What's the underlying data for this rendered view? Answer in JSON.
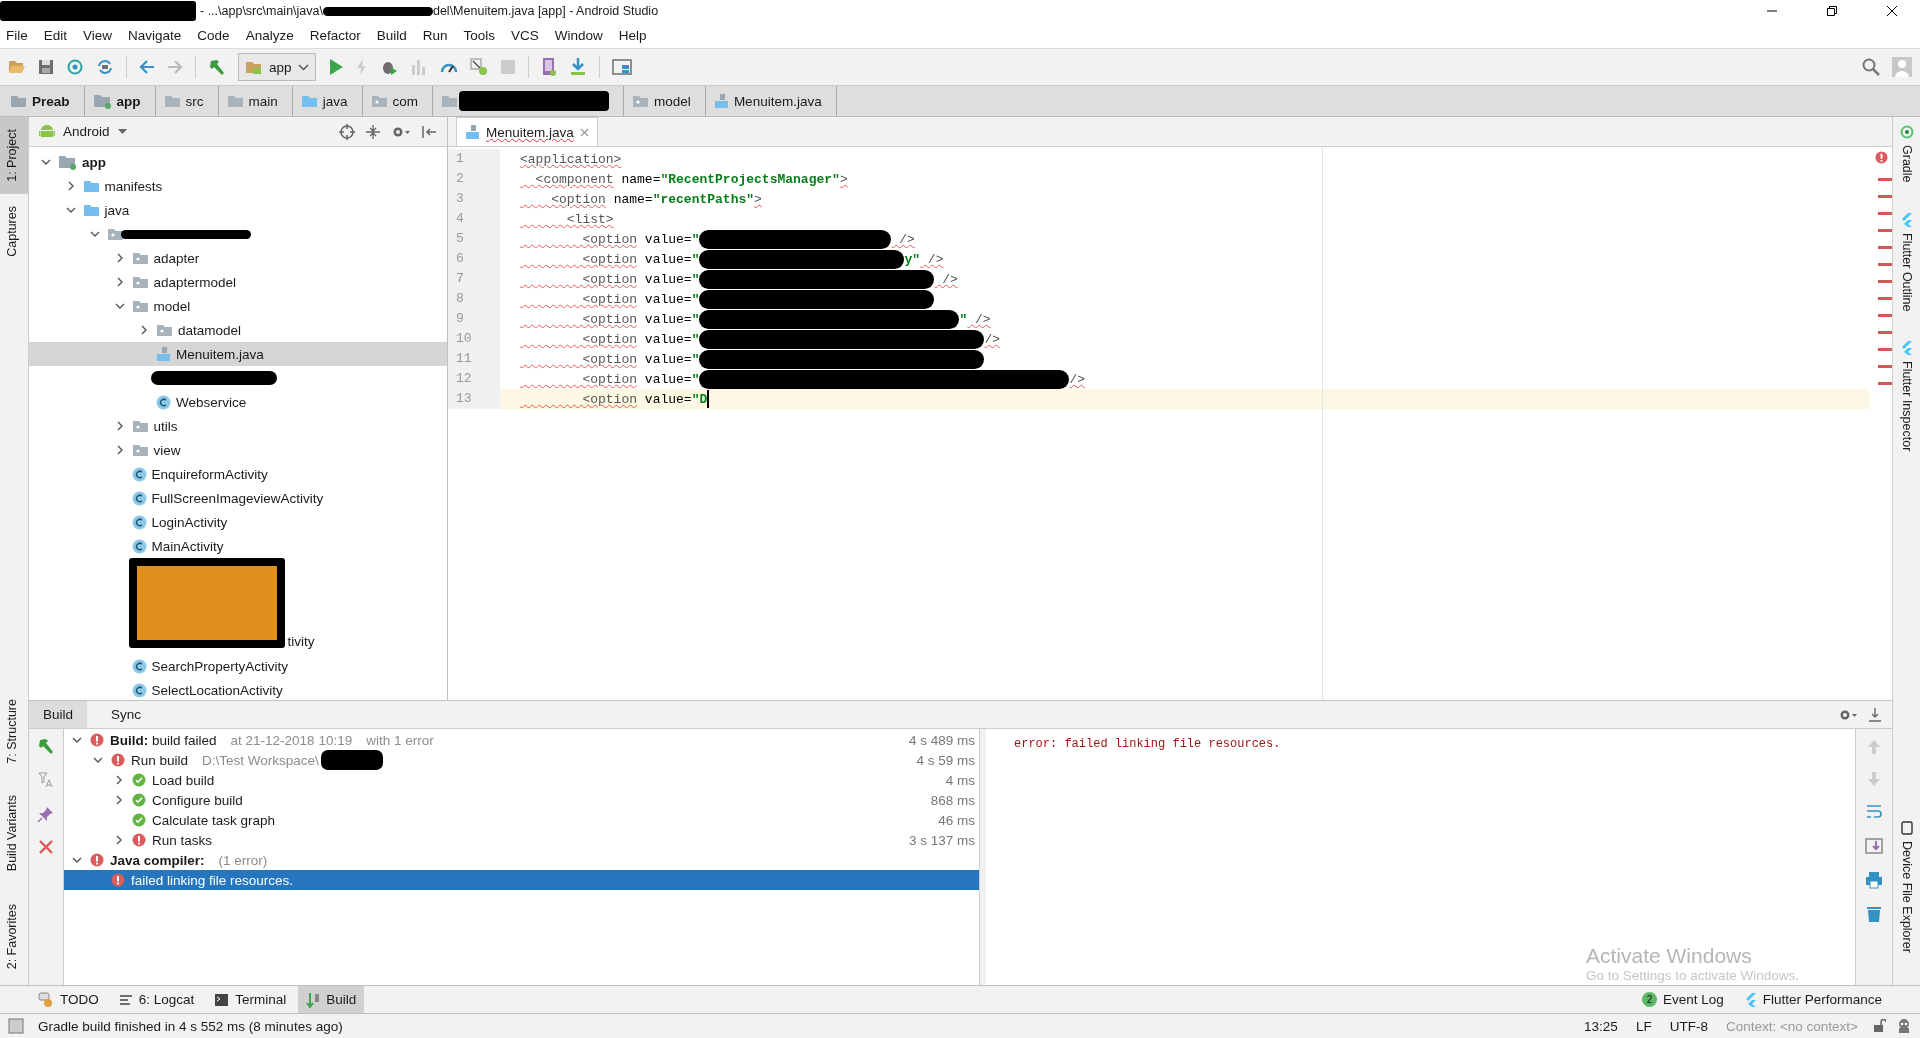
{
  "window": {
    "title_parts": [
      "- ...\\app\\src\\main\\java\\",
      "del\\Menuitem.java [app] - Android Studio"
    ]
  },
  "menu": [
    "File",
    "Edit",
    "View",
    "Navigate",
    "Code",
    "Analyze",
    "Refactor",
    "Build",
    "Run",
    "Tools",
    "VCS",
    "Window",
    "Help"
  ],
  "toolbar": {
    "run_config": "app"
  },
  "breadcrumbs": [
    {
      "label": "Preab",
      "kind": "project"
    },
    {
      "label": "app",
      "kind": "module"
    },
    {
      "label": "src",
      "kind": "folder"
    },
    {
      "label": "main",
      "kind": "folder"
    },
    {
      "label": "java",
      "kind": "source"
    },
    {
      "label": "com",
      "kind": "package"
    },
    {
      "kind": "redacted"
    },
    {
      "label": "model",
      "kind": "package"
    },
    {
      "label": "Menuitem.java",
      "kind": "file"
    }
  ],
  "left_tools_top": [
    {
      "label": "1: Project",
      "selected": true
    },
    {
      "label": "Captures",
      "selected": false
    }
  ],
  "left_tools_bottom": [
    {
      "label": "7: Structure",
      "selected": false
    },
    {
      "label": "Build Variants",
      "selected": false
    },
    {
      "label": "2: Favorites",
      "selected": false
    }
  ],
  "right_tools": [
    {
      "label": "Gradle",
      "kind": "gradle"
    },
    {
      "label": "Flutter Outline",
      "kind": "flutter"
    },
    {
      "label": "Flutter Inspector",
      "kind": "flutter"
    },
    {
      "label": "Device File Explorer",
      "kind": "device"
    }
  ],
  "project": {
    "view": "Android",
    "tree": [
      {
        "label": "app",
        "kind": "module",
        "expanded": true,
        "selected": false,
        "children": [
          {
            "label": "manifests",
            "kind": "source",
            "expanded": false,
            "selected": false
          },
          {
            "label": "java",
            "kind": "source",
            "expanded": true,
            "selected": false,
            "children": [
              {
                "kind": "redacted-package",
                "expanded": true,
                "selected": false,
                "children": [
                  {
                    "label": "adapter",
                    "kind": "package",
                    "expanded": false,
                    "selected": false
                  },
                  {
                    "label": "adaptermodel",
                    "kind": "package",
                    "expanded": false,
                    "selected": false
                  },
                  {
                    "label": "model",
                    "kind": "package",
                    "expanded": true,
                    "selected": false,
                    "children": [
                      {
                        "label": "datamodel",
                        "kind": "package",
                        "expanded": false,
                        "selected": false
                      },
                      {
                        "label": "Menuitem.java",
                        "kind": "file",
                        "selected": true
                      },
                      {
                        "kind": "redacted",
                        "selected": false
                      },
                      {
                        "label": "Webservice",
                        "kind": "class",
                        "selected": false
                      }
                    ]
                  },
                  {
                    "label": "utils",
                    "kind": "package",
                    "expanded": false,
                    "selected": false
                  },
                  {
                    "label": "view",
                    "kind": "package",
                    "expanded": false,
                    "selected": false
                  },
                  {
                    "label": "EnquireformActivity",
                    "kind": "class",
                    "selected": false
                  },
                  {
                    "label": "FullScreenImageviewActivity",
                    "kind": "class",
                    "selected": false
                  },
                  {
                    "label": "LoginActivity",
                    "kind": "class",
                    "selected": false
                  },
                  {
                    "label": "MainActivity",
                    "kind": "class",
                    "selected": false
                  },
                  {
                    "label": "tivity",
                    "kind": "covered",
                    "selected": false
                  },
                  {
                    "label": "SearchPropertyActivity",
                    "kind": "class",
                    "selected": false
                  },
                  {
                    "label": "SelectLocationActivity",
                    "kind": "class",
                    "selected": false
                  }
                ]
              }
            ]
          }
        ]
      }
    ]
  },
  "editor": {
    "tab": "Menuitem.java",
    "lines": [
      {
        "number": "1",
        "current": false,
        "code": [
          {
            "kind": "tag",
            "t": "<application>"
          }
        ]
      },
      {
        "number": "2",
        "current": false,
        "code": [
          {
            "kind": "tag",
            "t": "  <component"
          },
          {
            "kind": "attr",
            "t": " name="
          },
          {
            "kind": "value",
            "t": "\"RecentProjectsManager\""
          },
          {
            "kind": "tag",
            "t": ">"
          }
        ]
      },
      {
        "number": "3",
        "current": false,
        "code": [
          {
            "kind": "tag",
            "t": "    <option"
          },
          {
            "kind": "attr",
            "t": " name="
          },
          {
            "kind": "value",
            "t": "\"recentPaths\""
          },
          {
            "kind": "tag",
            "t": ">"
          }
        ]
      },
      {
        "number": "4",
        "current": false,
        "code": [
          {
            "kind": "tag",
            "t": "      <list>"
          }
        ]
      },
      {
        "number": "5",
        "current": false,
        "code": [
          {
            "kind": "tag",
            "t": "        <option"
          },
          {
            "kind": "attr",
            "t": " value="
          },
          {
            "kind": "value",
            "t": "\""
          },
          {
            "kind": "redaction"
          },
          {
            "kind": "tag",
            "t": " />"
          }
        ]
      },
      {
        "number": "6",
        "current": false,
        "code": [
          {
            "kind": "tag",
            "t": "        <option"
          },
          {
            "kind": "attr",
            "t": " value="
          },
          {
            "kind": "value",
            "t": "\""
          },
          {
            "kind": "redaction"
          },
          {
            "kind": "value",
            "t": "y\""
          },
          {
            "kind": "tag",
            "t": " />"
          }
        ]
      },
      {
        "number": "7",
        "current": false,
        "code": [
          {
            "kind": "tag",
            "t": "        <option"
          },
          {
            "kind": "attr",
            "t": " value="
          },
          {
            "kind": "value",
            "t": "\""
          },
          {
            "kind": "redaction"
          },
          {
            "kind": "tag",
            "t": " />"
          }
        ]
      },
      {
        "number": "8",
        "current": false,
        "code": [
          {
            "kind": "tag",
            "t": "        <option"
          },
          {
            "kind": "attr",
            "t": " value="
          },
          {
            "kind": "value",
            "t": "\""
          },
          {
            "kind": "redaction"
          }
        ]
      },
      {
        "number": "9",
        "current": false,
        "code": [
          {
            "kind": "tag",
            "t": "        <option"
          },
          {
            "kind": "attr",
            "t": " value="
          },
          {
            "kind": "value",
            "t": "\""
          },
          {
            "kind": "redaction"
          },
          {
            "kind": "value",
            "t": "\""
          },
          {
            "kind": "tag",
            "t": " />"
          }
        ]
      },
      {
        "number": "10",
        "current": false,
        "code": [
          {
            "kind": "tag",
            "t": "        <option"
          },
          {
            "kind": "attr",
            "t": " value="
          },
          {
            "kind": "value",
            "t": "\""
          },
          {
            "kind": "redaction"
          },
          {
            "kind": "tag",
            "t": "/>"
          }
        ]
      },
      {
        "number": "11",
        "current": false,
        "code": [
          {
            "kind": "tag",
            "t": "        <option"
          },
          {
            "kind": "attr",
            "t": " value="
          },
          {
            "kind": "value",
            "t": "\""
          },
          {
            "kind": "redaction"
          }
        ]
      },
      {
        "number": "12",
        "current": false,
        "code": [
          {
            "kind": "tag",
            "t": "        <option"
          },
          {
            "kind": "attr",
            "t": " value="
          },
          {
            "kind": "value",
            "t": "\""
          },
          {
            "kind": "redaction"
          },
          {
            "kind": "tag",
            "t": "/>"
          }
        ]
      },
      {
        "number": "13",
        "current": true,
        "code": [
          {
            "kind": "tag",
            "t": "        <option"
          },
          {
            "kind": "attr",
            "t": " value="
          },
          {
            "kind": "value",
            "t": "\"D"
          }
        ]
      }
    ]
  },
  "build": {
    "tabs": [
      {
        "label": "Build",
        "selected": true
      },
      {
        "label": "Sync",
        "selected": false
      }
    ],
    "tree": [
      {
        "label": "**Build:** build failed",
        "kind": "error",
        "expanded": true,
        "selected": false,
        "details": [
          "at 21-12-2018 10:19",
          "with 1 error"
        ],
        "time": "4 s 489 ms",
        "children": [
          {
            "label": "Run build",
            "kind": "error",
            "expanded": true,
            "selected": false,
            "details": [
              "D:\\Test Workspace\\"
            ],
            "redacted": true,
            "time": "4 s 59 ms",
            "children": [
              {
                "label": "Load build",
                "kind": "ok",
                "expanded": false,
                "selected": false,
                "time": "4 ms"
              },
              {
                "label": "Configure build",
                "kind": "ok",
                "expanded": false,
                "selected": false,
                "time": "868 ms"
              },
              {
                "label": "Calculate task graph",
                "kind": "ok",
                "selected": false,
                "time": "46 ms"
              },
              {
                "label": "Run tasks",
                "kind": "error",
                "expanded": false,
                "selected": false,
                "time": "3 s 137 ms"
              }
            ]
          }
        ]
      },
      {
        "label": "**Java compiler:**",
        "kind": "error",
        "expanded": true,
        "selected": false,
        "details": [
          "(1 error)"
        ],
        "children": [
          {
            "label": "failed linking file resources.",
            "kind": "error",
            "selected": true
          }
        ]
      }
    ],
    "console": "error: failed linking file resources."
  },
  "os_overlay": [
    "Activate Windows",
    "Go to Settings to activate Windows."
  ],
  "bottom_tabs": [
    {
      "label": "TODO",
      "kind": "todo",
      "selected": false
    },
    {
      "label": "6: Logcat",
      "kind": "logcat",
      "selected": false
    },
    {
      "label": "Terminal",
      "kind": "terminal",
      "selected": false
    },
    {
      "label": "Build",
      "kind": "build",
      "selected": true
    }
  ],
  "bottom_right": [
    {
      "label": "Event Log",
      "badge": "2",
      "kind": "events"
    },
    {
      "label": "Flutter Performance",
      "kind": "flutter"
    }
  ],
  "status_bar": {
    "message": "Gradle build finished in 4 s 552 ms (8 minutes ago)",
    "position": "13:25",
    "line_separator": "LF",
    "encoding": "UTF-8",
    "context": "Context: <no context>"
  }
}
